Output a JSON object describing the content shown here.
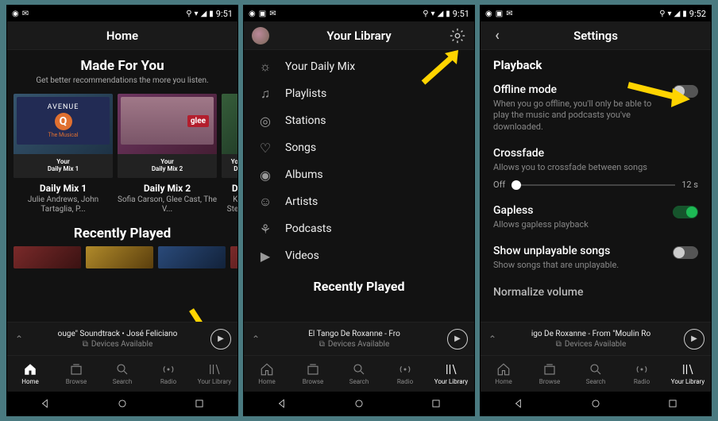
{
  "status": {
    "time": "9:51",
    "time2": "9:52"
  },
  "screens": {
    "home": {
      "header": "Home",
      "madefor": {
        "title": "Made For You",
        "sub": "Get better recommendations the more you listen."
      },
      "mixes": [
        {
          "strip1": "Your",
          "strip2": "Daily Mix 1",
          "name": "Daily Mix 1",
          "meta": "Julie Andrews, John Tartaglia, P..."
        },
        {
          "strip1": "Your",
          "strip2": "Daily Mix 2",
          "name": "Daily Mix 2",
          "meta": "Sofia Carson, Glee Cast, The V..."
        },
        {
          "strip1": "Your",
          "strip2": "Da",
          "name": "Da",
          "meta": "Ka\nStev..."
        }
      ],
      "recent_title": "Recently Played",
      "nowplaying": {
        "track": "ouge\" Soundtrack • José Feliciano",
        "devices": "Devices Available"
      }
    },
    "library": {
      "header": "Your Library",
      "items": [
        {
          "label": "Your Daily Mix",
          "icon": "sun"
        },
        {
          "label": "Playlists",
          "icon": "note"
        },
        {
          "label": "Stations",
          "icon": "radio"
        },
        {
          "label": "Songs",
          "icon": "heart"
        },
        {
          "label": "Albums",
          "icon": "disc"
        },
        {
          "label": "Artists",
          "icon": "person"
        },
        {
          "label": "Podcasts",
          "icon": "podcast"
        },
        {
          "label": "Videos",
          "icon": "video"
        }
      ],
      "recent_title": "Recently Played",
      "nowplaying": {
        "track": "El Tango De Roxanne - Fro",
        "devices": "Devices Available"
      }
    },
    "settings": {
      "header": "Settings",
      "section": "Playback",
      "rows": {
        "offline": {
          "title": "Offline mode",
          "desc": "When you go offline, you'll only be able to play the music and podcasts you've downloaded."
        },
        "crossfade": {
          "title": "Crossfade",
          "desc": "Allows you to crossfade between songs"
        },
        "crossfade_min": "Off",
        "crossfade_max": "12 s",
        "gapless": {
          "title": "Gapless",
          "desc": "Allows gapless playback"
        },
        "unplayable": {
          "title": "Show unplayable songs",
          "desc": "Show songs that are unplayable."
        },
        "normalize": {
          "title": "Normalize volume"
        }
      },
      "nowplaying": {
        "track": "igo De Roxanne - From \"Moulin Ro",
        "devices": "Devices Available"
      }
    }
  },
  "bottomnav": [
    {
      "label": "Home"
    },
    {
      "label": "Browse"
    },
    {
      "label": "Search"
    },
    {
      "label": "Radio"
    },
    {
      "label": "Your Library"
    }
  ]
}
